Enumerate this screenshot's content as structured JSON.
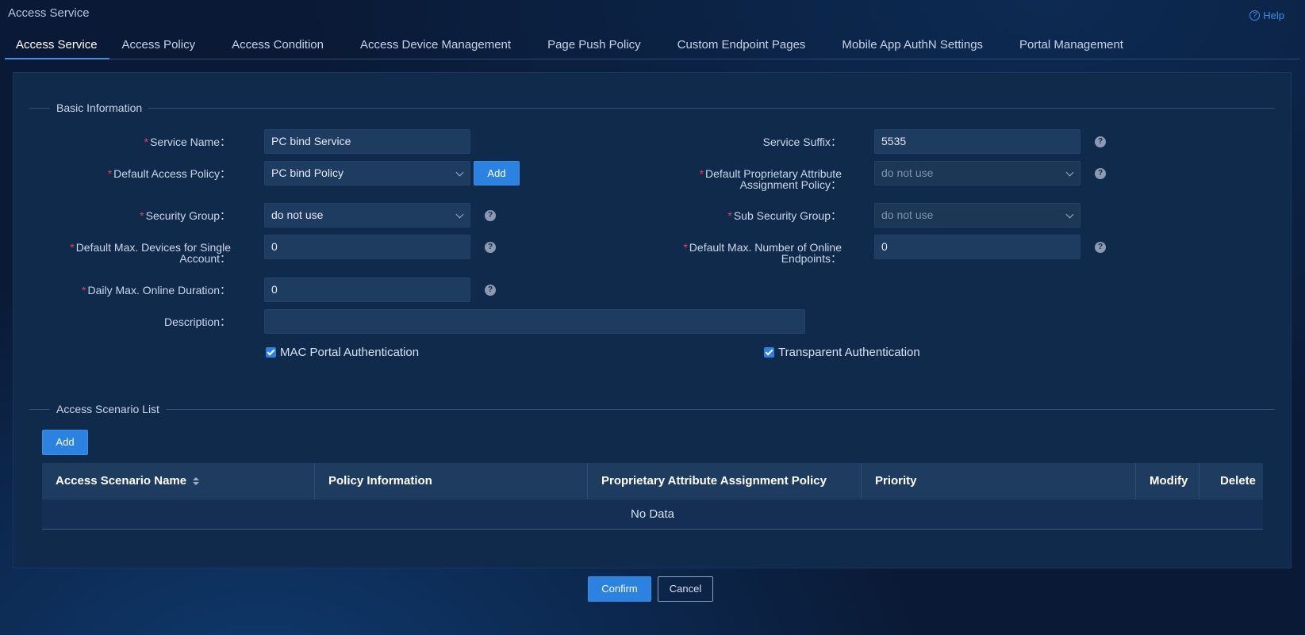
{
  "page": {
    "title": "Access Service",
    "help": "Help"
  },
  "tabs": [
    "Access Service",
    "Access Policy",
    "Access Condition",
    "Access Device Management",
    "Page Push Policy",
    "Custom Endpoint Pages",
    "Mobile App AuthN Settings",
    "Portal Management"
  ],
  "basic": {
    "title": "Basic Information",
    "service_name": {
      "label": "Service Name：",
      "value": "PC bind Service"
    },
    "service_suffix": {
      "label": "Service Suffix：",
      "value": "5535"
    },
    "default_access_policy": {
      "label": "Default Access Policy：",
      "value": "PC bind Policy",
      "add": "Add"
    },
    "default_prop_policy": {
      "label_1": "Default Proprietary Attribute",
      "label_2": "Assignment Policy：",
      "value": "do not use"
    },
    "security_group": {
      "label": "Security Group：",
      "value": "do not use"
    },
    "sub_security_group": {
      "label": "Sub Security Group：",
      "value": "do not use"
    },
    "max_devices": {
      "label_1": "Default Max. Devices for Single",
      "label_2": "Account：",
      "value": "0"
    },
    "max_online": {
      "label_1": "Default Max. Number of Online",
      "label_2": "Endpoints：",
      "value": "0"
    },
    "daily_duration": {
      "label": "Daily Max. Online Duration：",
      "value": "0"
    },
    "description": {
      "label": "Description：",
      "value": ""
    },
    "mac_portal": "MAC Portal Authentication",
    "transparent": "Transparent Authentication",
    "required_mark": "*",
    "help_mark": "?"
  },
  "scenario": {
    "title": "Access Scenario List",
    "add": "Add",
    "columns": [
      "Access Scenario Name",
      "Policy Information",
      "Proprietary Attribute Assignment Policy",
      "Priority",
      "Modify",
      "Delete"
    ],
    "empty": "No Data"
  },
  "footer": {
    "confirm": "Confirm",
    "cancel": "Cancel"
  }
}
